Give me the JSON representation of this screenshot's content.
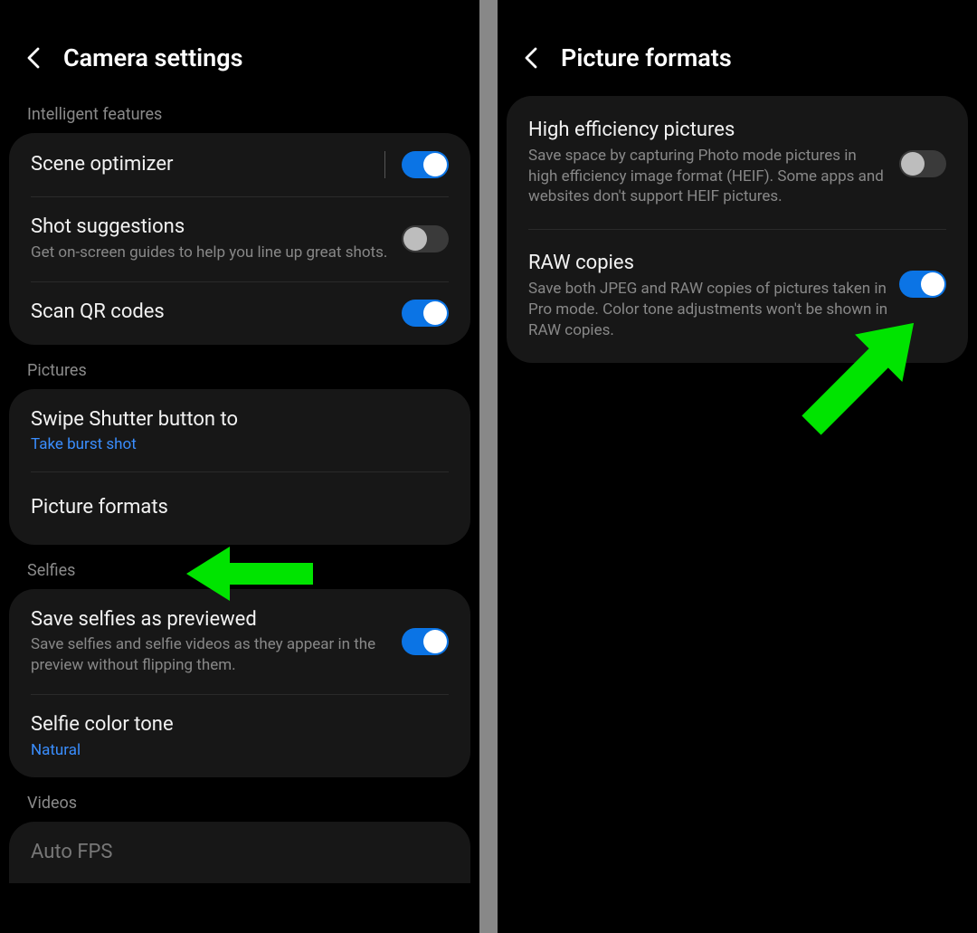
{
  "left": {
    "title": "Camera settings",
    "sections": {
      "intelligent": {
        "label": "Intelligent features",
        "scene_optimizer": {
          "title": "Scene optimizer",
          "on": true
        },
        "shot_suggestions": {
          "title": "Shot suggestions",
          "desc": "Get on-screen guides to help you line up great shots.",
          "on": false
        },
        "scan_qr": {
          "title": "Scan QR codes",
          "on": true
        }
      },
      "pictures": {
        "label": "Pictures",
        "swipe_shutter": {
          "title": "Swipe Shutter button to",
          "value": "Take burst shot"
        },
        "picture_formats": {
          "title": "Picture formats"
        }
      },
      "selfies": {
        "label": "Selfies",
        "save_as_previewed": {
          "title": "Save selfies as previewed",
          "desc": "Save selfies and selfie videos as they appear in the preview without flipping them.",
          "on": true
        },
        "color_tone": {
          "title": "Selfie color tone",
          "value": "Natural"
        }
      },
      "videos": {
        "label": "Videos",
        "auto_fps": {
          "title": "Auto FPS"
        }
      }
    }
  },
  "right": {
    "title": "Picture formats",
    "heif": {
      "title": "High efficiency pictures",
      "desc": "Save space by capturing Photo mode pictures in high efficiency image format (HEIF). Some apps and websites don't support HEIF pictures.",
      "on": false
    },
    "raw": {
      "title": "RAW copies",
      "desc": "Save both JPEG and RAW copies of pictures taken in Pro mode. Color tone adjustments won't be shown in RAW copies.",
      "on": true
    }
  },
  "annotations": {
    "color": "#00e400"
  }
}
